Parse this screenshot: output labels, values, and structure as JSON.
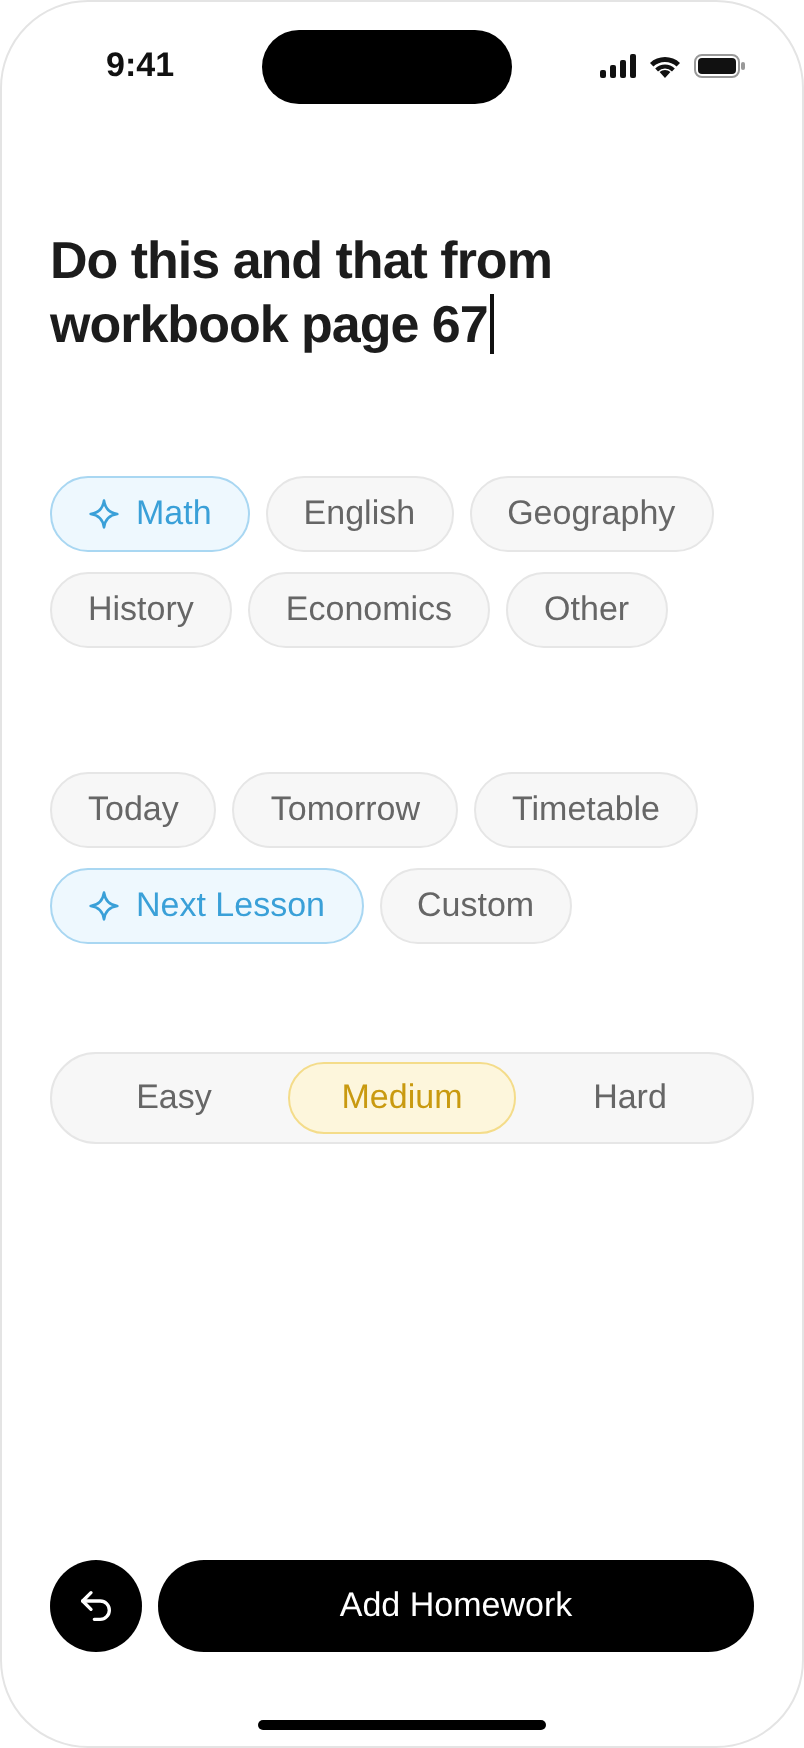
{
  "status_bar": {
    "time": "9:41"
  },
  "task_text": "Do this and that from workbook page 67",
  "subjects": [
    {
      "label": "Math",
      "selected": true
    },
    {
      "label": "English",
      "selected": false
    },
    {
      "label": "Geography",
      "selected": false
    },
    {
      "label": "History",
      "selected": false
    },
    {
      "label": "Economics",
      "selected": false
    },
    {
      "label": "Other",
      "selected": false
    }
  ],
  "due": [
    {
      "label": "Today",
      "selected": false
    },
    {
      "label": "Tomorrow",
      "selected": false
    },
    {
      "label": "Timetable",
      "selected": false
    },
    {
      "label": "Next Lesson",
      "selected": true
    },
    {
      "label": "Custom",
      "selected": false
    }
  ],
  "difficulty": [
    {
      "label": "Easy",
      "selected": false
    },
    {
      "label": "Medium",
      "selected": true
    },
    {
      "label": "Hard",
      "selected": false
    }
  ],
  "primary_button": "Add Homework"
}
